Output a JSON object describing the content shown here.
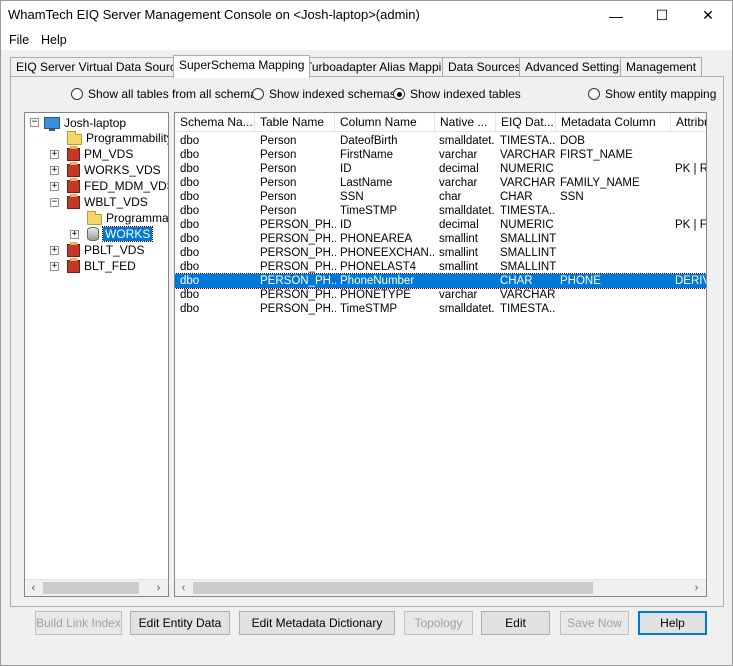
{
  "window": {
    "title": "WhamTech EIQ Server Management Console on <Josh-laptop>(admin)",
    "minimize_glyph": "—",
    "maximize_glyph": "☐",
    "close_glyph": "✕"
  },
  "menu": {
    "items": [
      "File",
      "Help"
    ]
  },
  "tabs": [
    "EIQ Server Virtual Data Sources",
    "SuperSchema Mapping",
    "Turboadapter Alias Mapping",
    "Data Sources",
    "Advanced Settings",
    "Management"
  ],
  "active_tab": "SuperSchema Mapping",
  "radio_options": [
    {
      "label": "Show all tables from all schemas",
      "checked": false
    },
    {
      "label": "Show indexed schemas",
      "checked": false
    },
    {
      "label": "Show indexed tables",
      "checked": true
    },
    {
      "label": "Show entity mapping",
      "checked": false
    }
  ],
  "tree": {
    "root": "Josh-laptop",
    "nodes": [
      {
        "label": "Programmability",
        "type": "folder-icon"
      },
      {
        "label": "PM_VDS",
        "type": "vds-icon"
      },
      {
        "label": "WORKS_VDS",
        "type": "vds-icon"
      },
      {
        "label": "FED_MDM_VDS",
        "type": "vds-icon"
      },
      {
        "label": "WBLT_VDS",
        "type": "vds-icon"
      },
      {
        "label": "Programmability",
        "type": "folder-icon"
      },
      {
        "label": "WORKS",
        "type": "database-icon"
      },
      {
        "label": "PBLT_VDS",
        "type": "vds-icon"
      },
      {
        "label": "BLT_FED",
        "type": "vds-icon"
      }
    ],
    "expander_plus": "+",
    "expander_minus": "−"
  },
  "grid": {
    "columns": [
      "Schema Na...",
      "Table Name",
      "Column Name",
      "Native ...",
      "EIQ Dat...",
      "Metadata Column",
      "Attribu"
    ],
    "rows": [
      [
        "dbo",
        "Person",
        "DateofBirth",
        "smalldatet...",
        "TIMESTA...",
        "DOB",
        ""
      ],
      [
        "dbo",
        "Person",
        "FirstName",
        "varchar",
        "VARCHAR",
        "FIRST_NAME",
        ""
      ],
      [
        "dbo",
        "Person",
        "ID",
        "decimal",
        "NUMERIC",
        "",
        "PK | RI"
      ],
      [
        "dbo",
        "Person",
        "LastName",
        "varchar",
        "VARCHAR",
        "FAMILY_NAME",
        ""
      ],
      [
        "dbo",
        "Person",
        "SSN",
        "char",
        "CHAR",
        "SSN",
        ""
      ],
      [
        "dbo",
        "Person",
        "TimeSTMP",
        "smalldatet...",
        "TIMESTA...",
        "",
        ""
      ],
      [
        "dbo",
        "PERSON_PH...",
        "ID",
        "decimal",
        "NUMERIC",
        "",
        "PK | FK"
      ],
      [
        "dbo",
        "PERSON_PH...",
        "PHONEAREA",
        "smallint",
        "SMALLINT",
        "",
        ""
      ],
      [
        "dbo",
        "PERSON_PH...",
        "PHONEEXCHAN...",
        "smallint",
        "SMALLINT",
        "",
        ""
      ],
      [
        "dbo",
        "PERSON_PH...",
        "PHONELAST4",
        "smallint",
        "SMALLINT",
        "",
        ""
      ],
      [
        "dbo",
        "PERSON_PH...",
        "PhoneNumber",
        "",
        "CHAR",
        "PHONE",
        "DERIV"
      ],
      [
        "dbo",
        "PERSON_PH...",
        "PHONETYPE",
        "varchar",
        "VARCHAR",
        "",
        ""
      ],
      [
        "dbo",
        "PERSON_PH...",
        "TimeSTMP",
        "smalldatet...",
        "TIMESTA...",
        "",
        ""
      ]
    ],
    "selected_row_index": 10
  },
  "buttons": {
    "build_link_index": "Build Link Index",
    "edit_entity_data": "Edit Entity Data",
    "edit_metadata_dictionary": "Edit Metadata Dictionary",
    "topology": "Topology",
    "edit": "Edit",
    "save_now": "Save Now",
    "help": "Help"
  },
  "scroll": {
    "left_arrow": "‹",
    "right_arrow": "›"
  }
}
